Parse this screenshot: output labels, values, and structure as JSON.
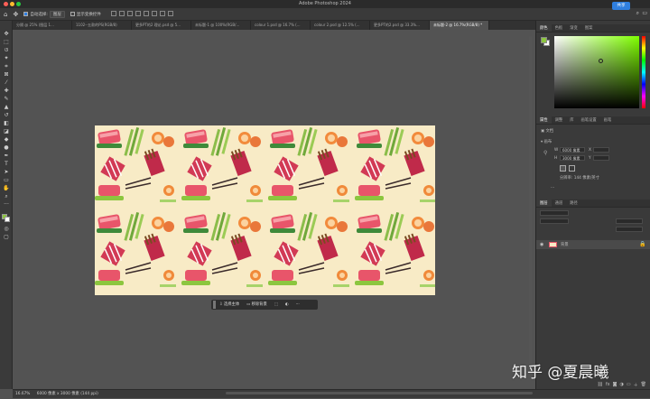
{
  "app": {
    "title": "Adobe Photoshop 2024",
    "share_label": "共享"
  },
  "options_bar": {
    "auto_select_label": "自动选择:",
    "auto_select_value": "图层",
    "show_transform_label": "显示变换控件"
  },
  "document_tabs": [
    "分隔 @ 25% (图层 1...",
    "1102--五款的PS(RGB/8)",
    "更多PT的2 理论.psd @ 5...",
    "未标题-1 @ 100%(RGB/...",
    "colour 1.psd @ 16.7% (...",
    "colour 2.psd @ 12.5% (...",
    "更多PT的2.psd @ 33.3%...",
    "未标题-2 @ 16.7%(RGB/8) *"
  ],
  "active_tab_index": 7,
  "context_bar": {
    "select_subject": "选择主体",
    "remove_bg": "移除背景",
    "more": "···"
  },
  "color_panel": {
    "tabs": [
      "颜色",
      "色板",
      "渐变",
      "图案"
    ],
    "fg_color": "#8cc63f",
    "bg_color": "#ffffff",
    "hue_color": "#7fff00"
  },
  "properties_panel": {
    "tabs": [
      "属性",
      "调整",
      "库",
      "画笔设置",
      "画笔"
    ],
    "doc_label": "文档",
    "canvas_label": "画布",
    "w_label": "W",
    "w_value": "6000 像素",
    "h_label": "H",
    "h_value": "3000 像素",
    "x_label": "X",
    "y_label": "Y",
    "resolution": "分辨率: 144 像素/英寸",
    "more": "···"
  },
  "layers_panel": {
    "tabs": [
      "图层",
      "通道",
      "路径"
    ],
    "layer_name": "背景"
  },
  "status": {
    "zoom": "16.67%",
    "info": "6000 像素 x 3000 像素 (144 ppi)"
  },
  "watermark": "知乎 @夏晨曦"
}
